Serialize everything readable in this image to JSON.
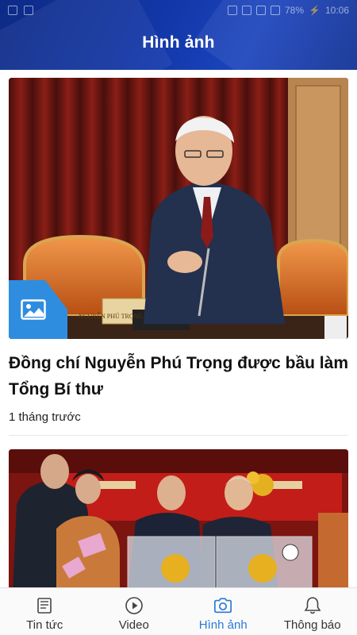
{
  "status_bar": {
    "battery": "78%",
    "time": "10:06"
  },
  "header": {
    "title": "Hình ảnh"
  },
  "feed": {
    "articles": [
      {
        "title": "Đồng chí Nguyễn Phú Trọng được bầu làm Tổng Bí thư",
        "time": "1 tháng trước",
        "plaque": "NGUYỄN PHÚ TRỌNG"
      },
      {
        "title": "",
        "time": ""
      }
    ]
  },
  "bottom_nav": {
    "items": [
      {
        "label": "Tin tức",
        "icon": "news-icon",
        "active": false
      },
      {
        "label": "Video",
        "icon": "play-circle-icon",
        "active": false
      },
      {
        "label": "Hình ảnh",
        "icon": "camera-icon",
        "active": true
      },
      {
        "label": "Thông báo",
        "icon": "bell-icon",
        "active": false
      }
    ]
  },
  "colors": {
    "header": "#1237a8",
    "active": "#2979d8",
    "badge": "#2f8de0"
  }
}
